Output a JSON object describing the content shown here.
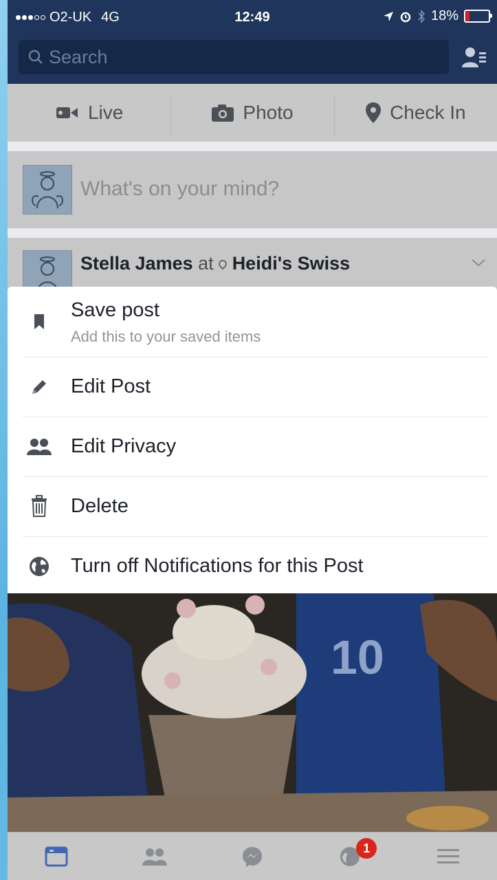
{
  "status_bar": {
    "carrier": "O2-UK",
    "network": "4G",
    "time": "12:49",
    "battery": "18%",
    "battery_level": 0.18
  },
  "search": {
    "placeholder": "Search"
  },
  "composer": {
    "live_label": "Live",
    "photo_label": "Photo",
    "checkin_label": "Check In"
  },
  "status_prompt": "What's on your mind?",
  "post": {
    "author": "Stella James",
    "at": "at",
    "place": "Heidi's Swiss"
  },
  "menu": {
    "items": [
      {
        "label": "Save post",
        "sublabel": "Add this to your saved items",
        "icon": "bookmark-icon"
      },
      {
        "label": "Edit Post",
        "icon": "pencil-icon"
      },
      {
        "label": "Edit Privacy",
        "icon": "people-icon"
      },
      {
        "label": "Delete",
        "icon": "trash-icon"
      },
      {
        "label": "Turn off Notifications for this Post",
        "icon": "globe-icon"
      }
    ]
  },
  "tabbar": {
    "notification_count": "1",
    "active_color": "#4267b2"
  },
  "colors": {
    "header": "#1f355b",
    "accent": "#4267b2",
    "badge": "#d9261c"
  }
}
